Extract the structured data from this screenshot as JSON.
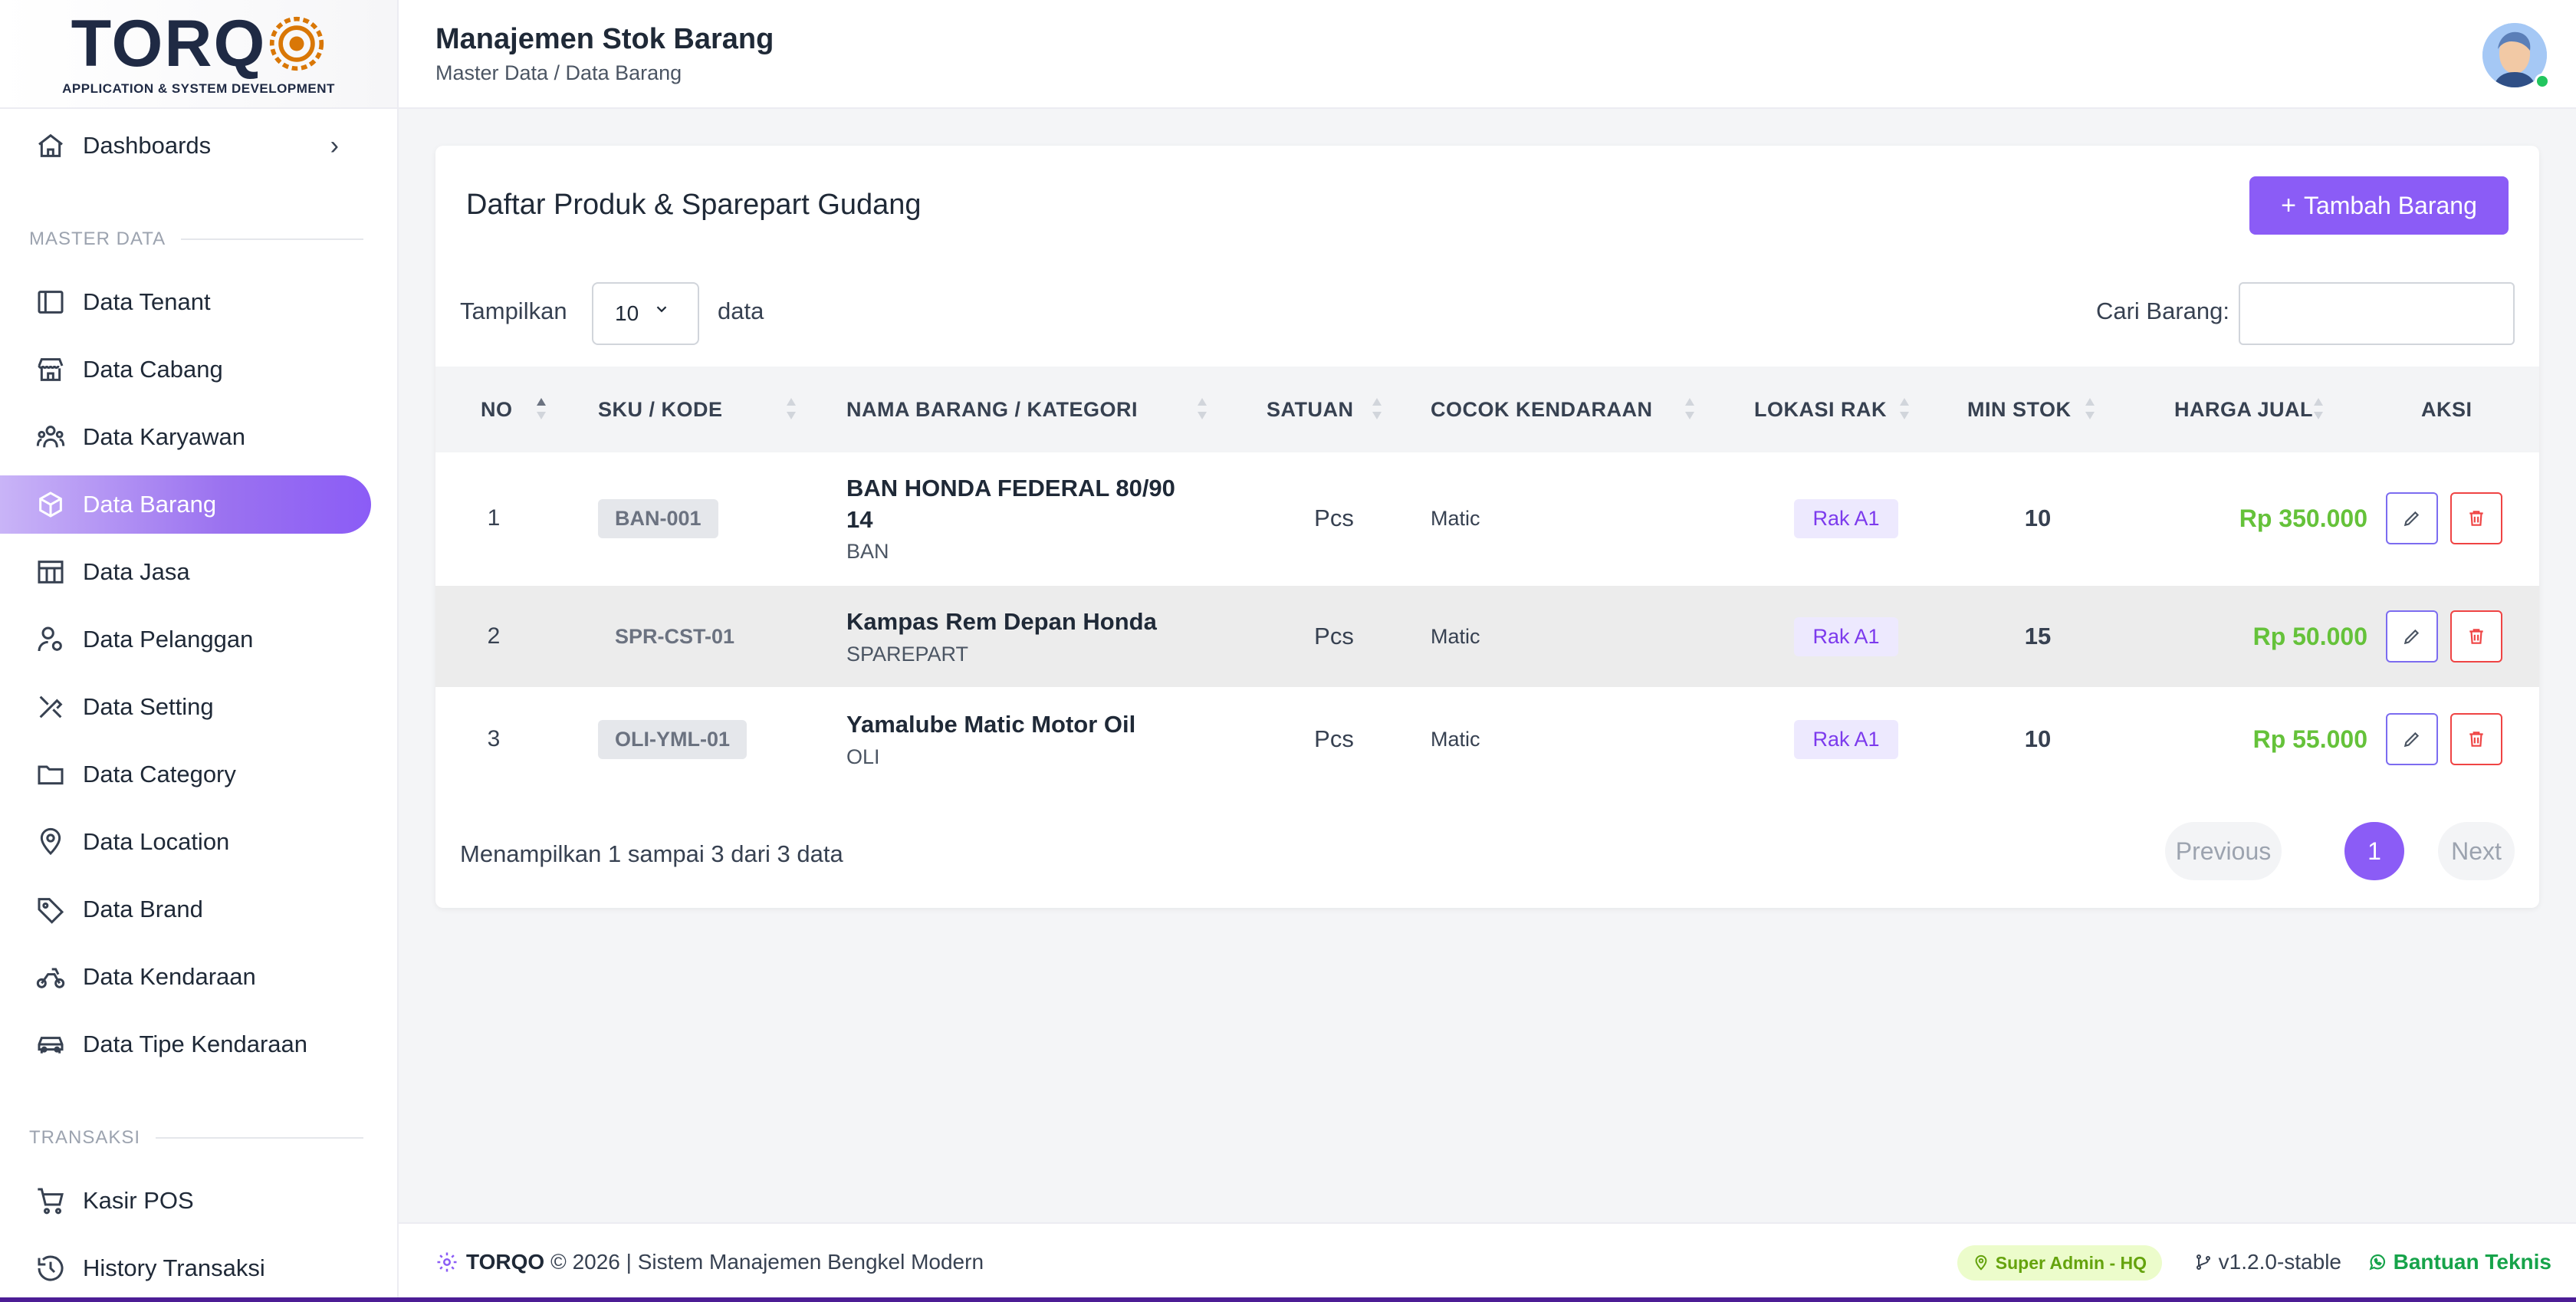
{
  "app": {
    "logo_text": "TORQ",
    "logo_sub": "APPLICATION & SYSTEM DEVELOPMENT"
  },
  "sidebar": {
    "dashboards": "Dashboards",
    "section_master": "MASTER DATA",
    "items": [
      {
        "label": "Data Tenant",
        "icon": "layout-icon"
      },
      {
        "label": "Data Cabang",
        "icon": "store-icon"
      },
      {
        "label": "Data Karyawan",
        "icon": "users-icon"
      },
      {
        "label": "Data Barang",
        "icon": "box-icon",
        "active": true
      },
      {
        "label": "Data Jasa",
        "icon": "table-icon"
      },
      {
        "label": "Data Pelanggan",
        "icon": "user-gear-icon"
      },
      {
        "label": "Data Setting",
        "icon": "tools-icon"
      },
      {
        "label": "Data Category",
        "icon": "folder-icon"
      },
      {
        "label": "Data Location",
        "icon": "map-pin-icon"
      },
      {
        "label": "Data Brand",
        "icon": "tag-icon"
      },
      {
        "label": "Data Kendaraan",
        "icon": "motorcycle-icon"
      },
      {
        "label": "Data Tipe Kendaraan",
        "icon": "car-icon"
      }
    ],
    "section_transaksi": "TRANSAKSI",
    "trans_items": [
      {
        "label": "Kasir POS",
        "icon": "cart-icon"
      },
      {
        "label": "History Transaksi",
        "icon": "history-icon"
      }
    ]
  },
  "header": {
    "title": "Manajemen Stok Barang",
    "breadcrumb": "Master Data / Data Barang"
  },
  "card": {
    "title": "Daftar Produk & Sparepart Gudang",
    "add_button": "Tambah Barang",
    "show_label": "Tampilkan",
    "page_length": "10",
    "data_label": "data",
    "search_label": "Cari Barang:",
    "search_value": ""
  },
  "table": {
    "headers": {
      "no": "NO",
      "sku": "SKU / KODE",
      "nama": "NAMA BARANG / KATEGORI",
      "satuan": "SATUAN",
      "cocok": "COCOK KENDARAAN",
      "lokasi": "LOKASI RAK",
      "min_stok": "MIN STOK",
      "harga": "HARGA JUAL",
      "aksi": "AKSI"
    },
    "rows": [
      {
        "no": "1",
        "sku": "BAN-001",
        "nama": "BAN HONDA FEDERAL 80/90 14",
        "kategori": "BAN",
        "satuan": "Pcs",
        "cocok": "Matic",
        "rak": "Rak A1",
        "min_stok": "10",
        "harga": "Rp 350.000"
      },
      {
        "no": "2",
        "sku": "SPR-CST-01",
        "nama": "Kampas Rem Depan Honda",
        "kategori": "SPAREPART",
        "satuan": "Pcs",
        "cocok": "Matic",
        "rak": "Rak A1",
        "min_stok": "15",
        "harga": "Rp 50.000"
      },
      {
        "no": "3",
        "sku": "OLI-YML-01",
        "nama": "Yamalube Matic Motor Oil",
        "kategori": "OLI",
        "satuan": "Pcs",
        "cocok": "Matic",
        "rak": "Rak A1",
        "min_stok": "10",
        "harga": "Rp 55.000"
      }
    ]
  },
  "pagination": {
    "info": "Menampilkan 1 sampai 3 dari 3 data",
    "previous": "Previous",
    "current": "1",
    "next": "Next"
  },
  "footer": {
    "brand": "TORQO",
    "text": "© 2026 | Sistem Manajemen Bengkel Modern",
    "badge": "Super Admin - HQ",
    "version": "v1.2.0-stable",
    "help": "Bantuan Teknis"
  },
  "colors": {
    "accent": "#8b5cf6",
    "price": "#65c23a",
    "danger": "#ef4444"
  }
}
